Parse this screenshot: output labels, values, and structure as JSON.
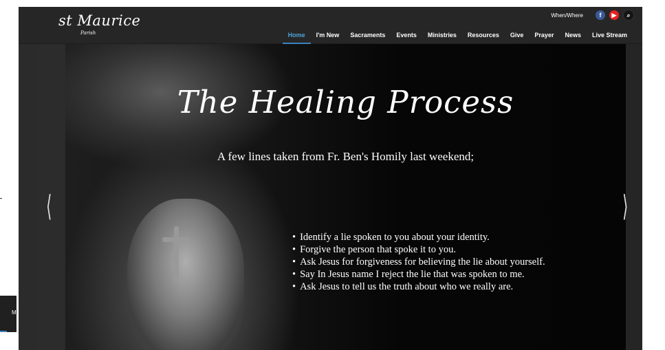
{
  "logo": {
    "main": "st Maurice",
    "sub": "Parish"
  },
  "utility": {
    "when_where": "When/Where",
    "facebook": "f",
    "youtube": "▶",
    "search": "⌕"
  },
  "nav": [
    "Home",
    "I'm New",
    "Sacraments",
    "Events",
    "Ministries",
    "Resources",
    "Give",
    "Prayer",
    "News",
    "Live Stream"
  ],
  "active_nav": "Home",
  "hero": {
    "title": "The Healing Process",
    "subtitle": "A few lines taken from Fr. Ben's Homily last weekend;",
    "bullets": [
      "Identify a lie spoken to you about your identity.",
      "Forgive the person that spoke it to you.",
      "Ask Jesus for forgiveness for believing the lie about yourself.",
      "Say In Jesus name I reject the lie that was spoken to me.",
      "Ask Jesus to tell us the truth about who we really are."
    ],
    "prev_arrow": "⟨",
    "next_arrow": "⟩"
  },
  "peek": {
    "label": "M"
  },
  "colors": {
    "accent": "#3b85c0",
    "nav_active": "#4fa3d9",
    "background": "#262626"
  }
}
